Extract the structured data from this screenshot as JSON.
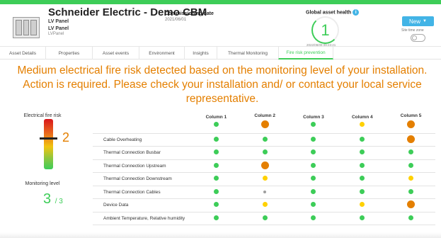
{
  "header": {
    "asset_title": "Schneider Electric - Demo CBM",
    "asset_lines": [
      "LV Panel",
      "LV Panel",
      "LVPanel"
    ],
    "commissioning_label": "Commissioning date",
    "commissioning_value": "2021/06/01",
    "health_label": "Global asset health",
    "health_value": "1",
    "health_timestamp": "2022/08/09 09:23:21",
    "new_button_label": "New",
    "timezone_label": "Site time zone"
  },
  "tabs": [
    {
      "label": "Asset Details"
    },
    {
      "label": "Properties"
    },
    {
      "label": "Asset events"
    },
    {
      "label": "Environment"
    },
    {
      "label": "Insights"
    },
    {
      "label": "Thermal Monitoring"
    },
    {
      "label": "Fire risk prevention"
    }
  ],
  "active_tab": "Fire risk prevention",
  "headline": "Medium electrical fire risk detected based on the monitoring level of your installation. Action is required. Please check your installation and/ or contact your local service representative.",
  "left_panel": {
    "fire_risk_label": "Electrical fire risk",
    "fire_risk_value": "2",
    "monitoring_label": "Monitoring level",
    "monitoring_value": "3",
    "monitoring_max": "/ 3"
  },
  "colors": {
    "green": "#3dcd58",
    "orange": "#e47f00",
    "yellow": "#ffd100",
    "grey": "#9e9e9e",
    "accent_blue": "#42b4e6"
  },
  "table": {
    "columns": [
      {
        "label": "Column 1",
        "status": "green"
      },
      {
        "label": "Column 2",
        "status": "orange"
      },
      {
        "label": "Column 3",
        "status": "green"
      },
      {
        "label": "Column 4",
        "status": "yellow"
      },
      {
        "label": "Column 5",
        "status": "orange"
      }
    ],
    "rows": [
      {
        "label": "Cable Overheating",
        "cells": [
          "green",
          "green",
          "green",
          "green",
          "orange"
        ]
      },
      {
        "label": "Thermal Connection Busbar",
        "cells": [
          "green",
          "green",
          "green",
          "green",
          "green"
        ]
      },
      {
        "label": "Thermal Connection Upstream",
        "cells": [
          "green",
          "orange",
          "green",
          "green",
          "green"
        ]
      },
      {
        "label": "Thermal Connection Downstream",
        "cells": [
          "green",
          "yellow",
          "green",
          "green",
          "yellow"
        ]
      },
      {
        "label": "Thermal Connection Cables",
        "cells": [
          "green",
          "grey",
          "green",
          "green",
          "green"
        ]
      },
      {
        "label": "Device Data",
        "cells": [
          "green",
          "yellow",
          "green",
          "yellow",
          "orange"
        ]
      },
      {
        "label": "Ambient Temperature, Relative humidity",
        "cells": [
          "green",
          "green",
          "green",
          "green",
          "green"
        ]
      }
    ]
  }
}
